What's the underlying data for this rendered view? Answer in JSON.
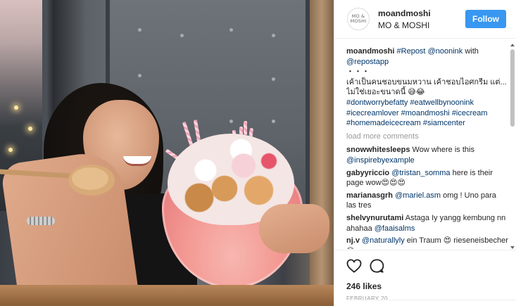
{
  "post": {
    "image_alt": "Woman smiling with a large ice cream sundae bowl",
    "avatar_text": "MO & MOSHI",
    "username": "moandmoshi",
    "location": "MO & MOSHI",
    "follow_label": "Follow"
  },
  "caption": {
    "username": "moandmoshi",
    "t1": "#Repost",
    "t2": " ",
    "t3": "@noonink",
    "t4": " with ",
    "t5": "@repostapp",
    "t6": "・・・",
    "t7": "เค้าเป็นคนชอบขนมหวาน เค้าชอบไอศกรีม แต่... ไม่ใช่เยอะขนาดนี้ 😅😂",
    "t8": "#dontworrybefatty",
    "t9": "#eatwellbynoonink",
    "t10": "#icecreamlover",
    "t11": "#moandmoshi",
    "t12": "#icecream",
    "t13": "#homemadeicecream",
    "t14": "#siamcenter"
  },
  "load_more_label": "load more comments",
  "comments": [
    {
      "username": "snowwhitesleeps",
      "text": " Wow where is this ",
      "mention": "@inspirebyexample",
      "after": ""
    },
    {
      "username": "gabyyriccio",
      "text": " ",
      "mention": "@tristan_somma",
      "after": " here is their page wow😍😍😍"
    },
    {
      "username": "marianasgrh",
      "text": " ",
      "mention": "@mariel.asm",
      "after": " omg ! Uno para las tres"
    },
    {
      "username": "shelvynurutami",
      "text": " Astaga Iy yangg kembung nn ahahaa ",
      "mention": "@faaisalms",
      "after": ""
    },
    {
      "username": "nj.v",
      "text": " ",
      "mention": "@naturallyly",
      "after": " ein Traum 😍 rieseneisbecher 😊"
    }
  ],
  "likes": "246 likes",
  "date": "FEBRUARY 20",
  "icons": {
    "like": "heart-icon",
    "comment": "comment-icon"
  },
  "colors": {
    "follow_button": "#3897f0",
    "hashtag": "#003569",
    "muted": "#999999"
  }
}
